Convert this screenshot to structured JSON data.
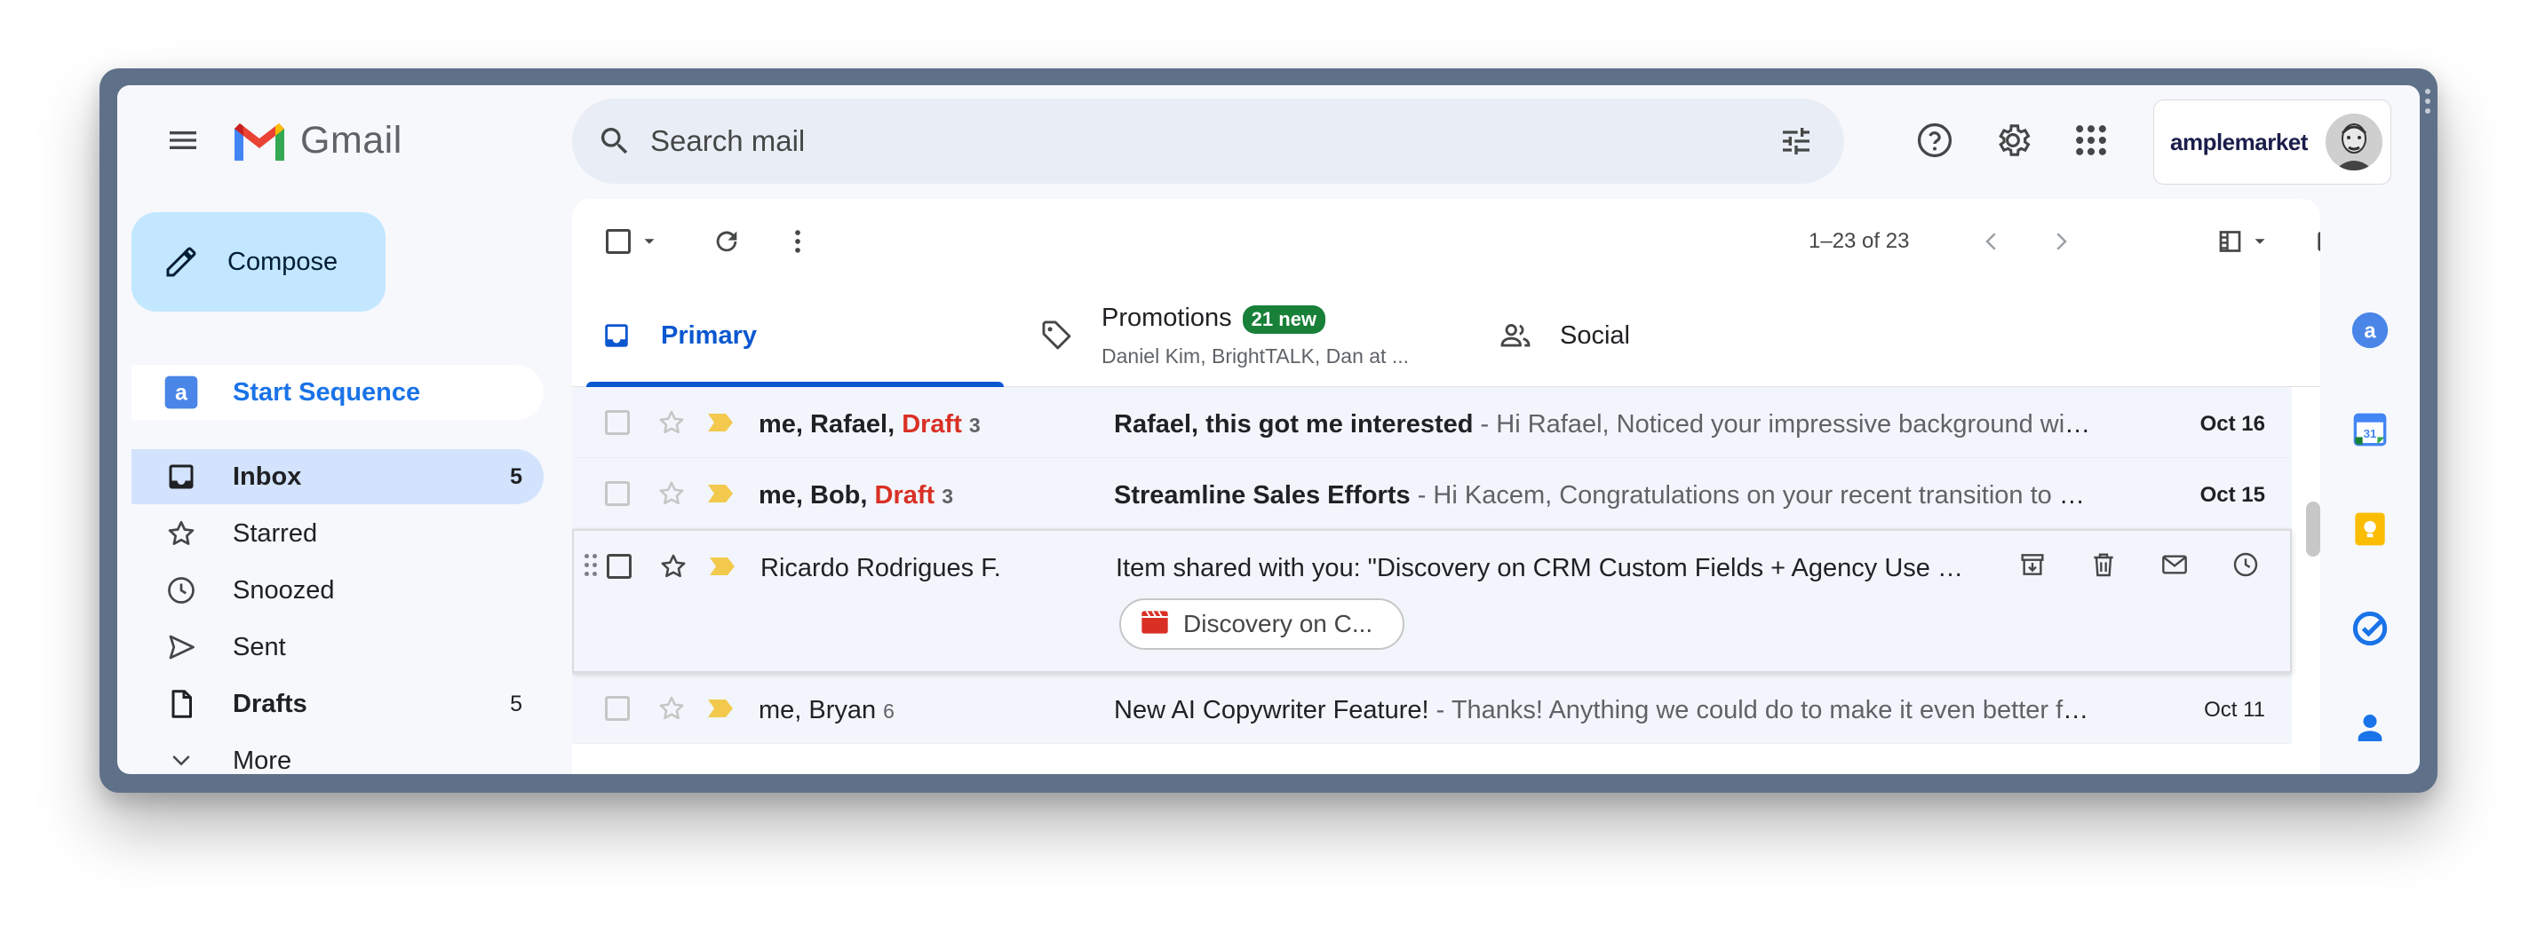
{
  "app": {
    "logo_text": "Gmail"
  },
  "search": {
    "placeholder": "Search mail"
  },
  "account": {
    "name": "amplemarket"
  },
  "compose": {
    "label": "Compose"
  },
  "nav": {
    "start_sequence": "Start Sequence",
    "items": [
      {
        "label": "Inbox",
        "count": "5",
        "active": true,
        "bold": true,
        "icon": "inbox-icon"
      },
      {
        "label": "Starred",
        "count": "",
        "icon": "star-icon"
      },
      {
        "label": "Snoozed",
        "count": "",
        "icon": "clock-icon"
      },
      {
        "label": "Sent",
        "count": "",
        "icon": "send-icon"
      },
      {
        "label": "Drafts",
        "count": "5",
        "bold": true,
        "icon": "draft-icon"
      },
      {
        "label": "More",
        "count": "",
        "icon": "chevron-down-icon"
      }
    ]
  },
  "toolbar": {
    "pager": "1–23 of 23"
  },
  "tabs": {
    "primary": "Primary",
    "promotions": "Promotions",
    "promotions_badge": "21 new",
    "promotions_senders": "Daniel Kim, BrightTALK, Dan at ...",
    "social": "Social"
  },
  "emails": [
    {
      "sender_me": "me, Rafael, ",
      "sender_draft": "Draft",
      "count": "3",
      "subject": "Rafael, this got me interested",
      "snippet": " - Hi Rafael, Noticed your impressive background with...",
      "date": "Oct 16"
    },
    {
      "sender_me": "me, Bob, ",
      "sender_draft": "Draft",
      "count": "3",
      "subject": "Streamline Sales Efforts",
      "snippet": " - Hi Kacem, Congratulations on your recent transition to En...",
      "date": "Oct 15"
    },
    {
      "sender": "Ricardo Rodrigues F.",
      "subject": "Item shared with you: \"Discovery on CRM Custom Fields + Agency Use Cas...",
      "attachment": "Discovery on C..."
    },
    {
      "sender": "me, Bryan",
      "count": "6",
      "subject": "New AI Copywriter Feature!",
      "snippet": " - Thanks! Anything we could do to make it even better for...",
      "date": "Oct 11"
    }
  ],
  "colors": {
    "accent": "#0b57d0",
    "compose_bg": "#c2e7ff",
    "active_nav": "#d3e3fd",
    "badge_green": "#188038",
    "draft_red": "#d93025",
    "important_marker": "#f2c94c"
  }
}
